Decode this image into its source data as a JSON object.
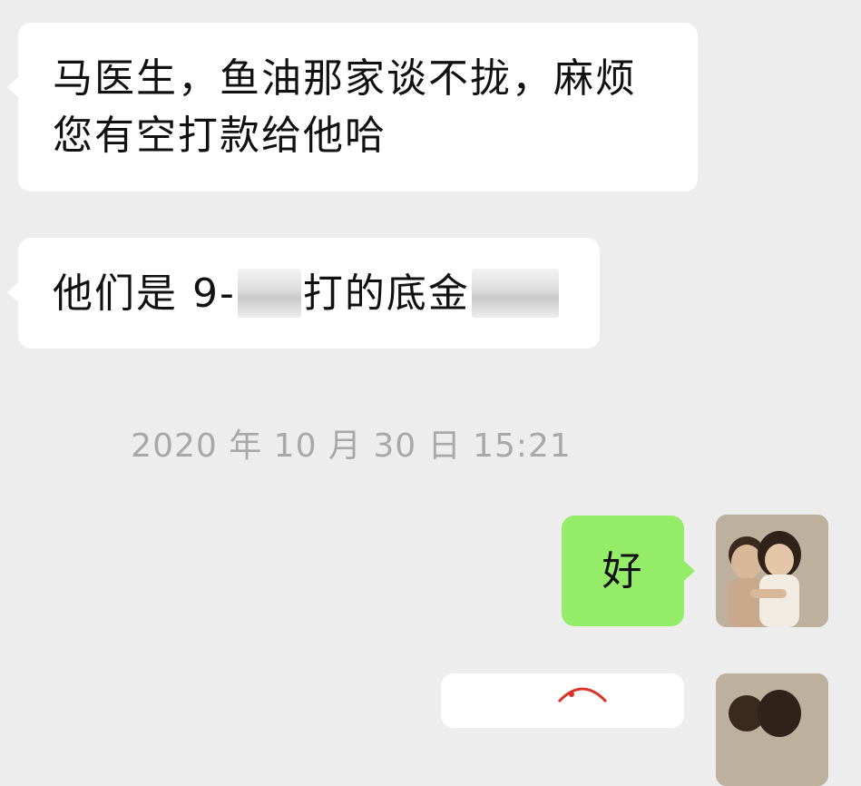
{
  "messages": [
    {
      "side": "incoming",
      "text": "马医生，鱼油那家谈不拢，麻烦您有空打款给他哈"
    },
    {
      "side": "incoming",
      "parts": [
        "他们是 9-",
        "打的底金"
      ]
    },
    {
      "side": "outgoing",
      "text": "好"
    }
  ],
  "timestamp": "2020 年 10 月 30 日 15:21",
  "colors": {
    "background": "#ededed",
    "incoming_bubble": "#ffffff",
    "outgoing_bubble": "#95ec69",
    "timestamp_text": "#a8a8a8"
  },
  "icons": {
    "avatar": "avatar-photo-two-children",
    "redaction": "mosaic-blur",
    "partial_content": "red-stamp-image"
  }
}
